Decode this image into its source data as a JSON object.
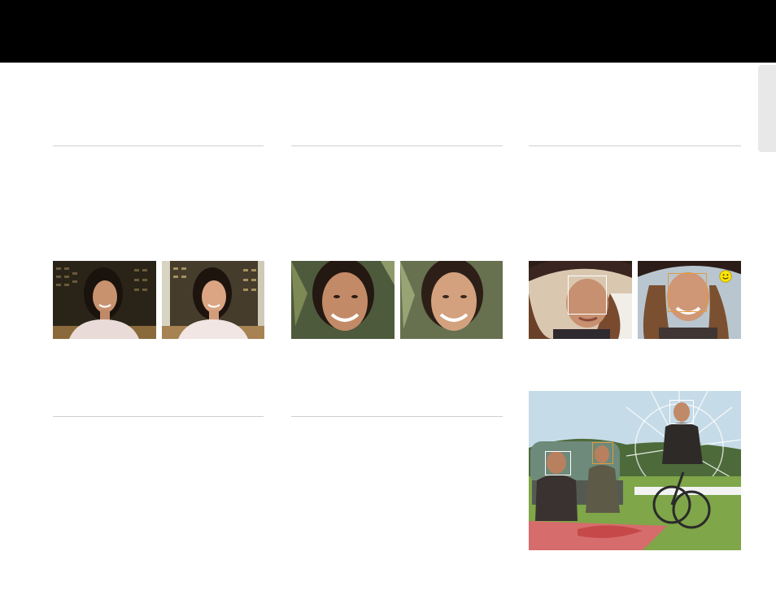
{
  "page": {
    "header_color": "#000000",
    "side_tab_color": "#e8e8e8"
  },
  "photos": {
    "col1_left": "portrait-woman-night-icon",
    "col1_right": "portrait-woman-night-bright-icon",
    "col2_left": "portrait-woman-closeup-icon",
    "col2_right": "portrait-woman-closeup-soft-icon",
    "col3_left": "woman-hat-face-detect-icon",
    "col3_right": "woman-hat-smile-detect-icon",
    "col3_bottom": "group-picnic-bicycle-face-detect-icon"
  },
  "colors": {
    "face_box_white": "#ffffff",
    "face_box_orange": "#e39a3b",
    "smile_icon": "#ffe600"
  }
}
